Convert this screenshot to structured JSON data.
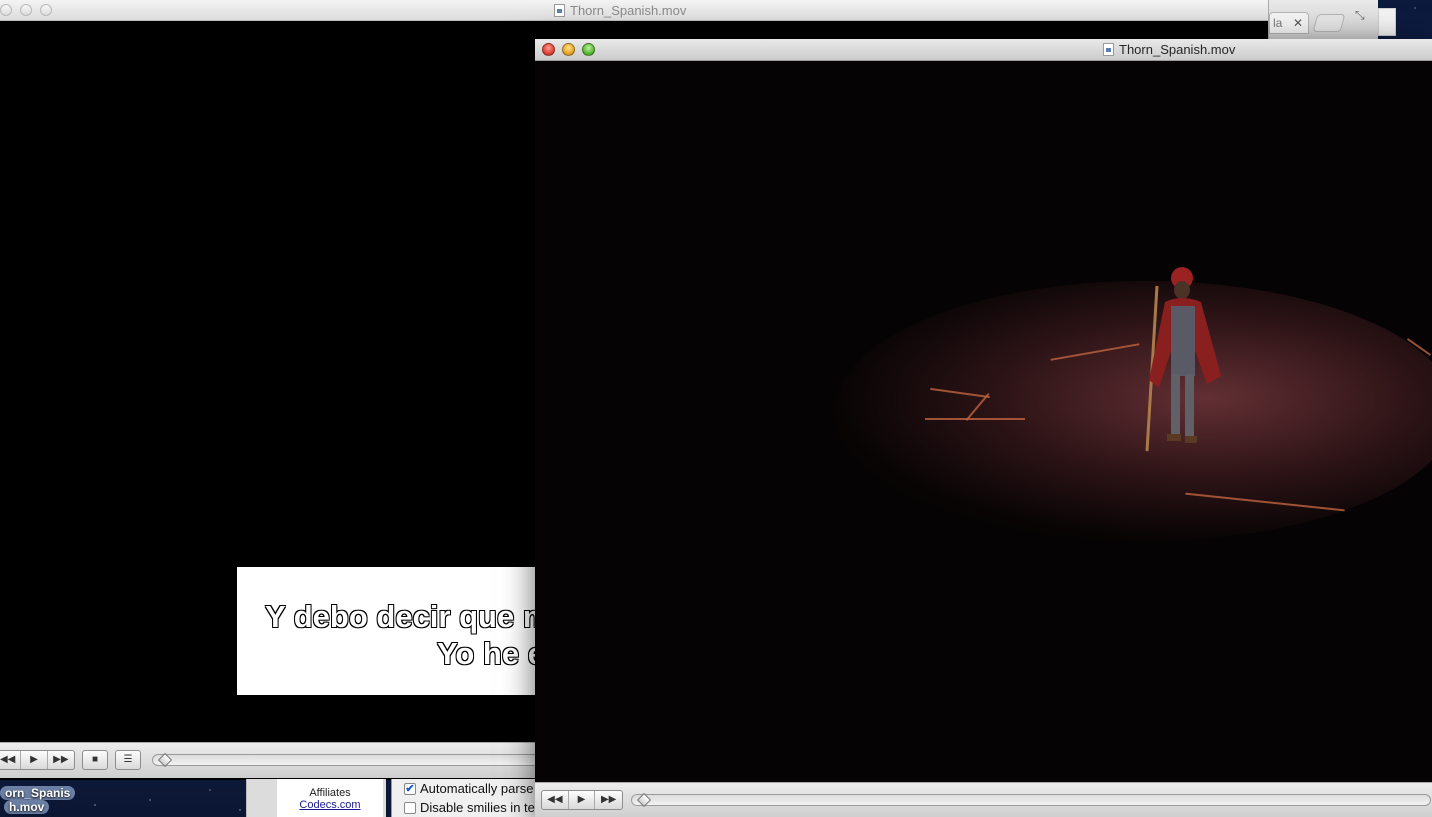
{
  "desktop": {
    "dock_label_line1": "orn_Spanis",
    "dock_label_line2": "h.mov"
  },
  "back_window": {
    "title": "Thorn_Spanish.mov",
    "subtitle_line1": "Y debo decir que m",
    "subtitle_line2": "Yo he e",
    "controls": {
      "rewind_glyph": "◀◀",
      "play_glyph": "▶",
      "forward_glyph": "▶▶",
      "stop_glyph": "■",
      "menu_glyph": "☰"
    }
  },
  "browser": {
    "tab_label": "la",
    "tab_close": "✕",
    "resize_glyph": "⤡"
  },
  "affiliates": {
    "label": "Affiliates",
    "link": "Codecs.com"
  },
  "preferences": {
    "option1_label": "Automatically parse",
    "option1_checked": "✔",
    "option2_label": "Disable smilies in te"
  },
  "front_window": {
    "title": "Thorn_Spanish.mov",
    "controls": {
      "rewind_glyph": "◀◀",
      "play_glyph": "▶",
      "forward_glyph": "▶▶"
    },
    "seek_position": 0.0
  },
  "colors": {
    "close": "#e0443a",
    "minimize": "#e8a72a",
    "maximize": "#5dbb3a",
    "costume_red": "#8a1f1f"
  }
}
